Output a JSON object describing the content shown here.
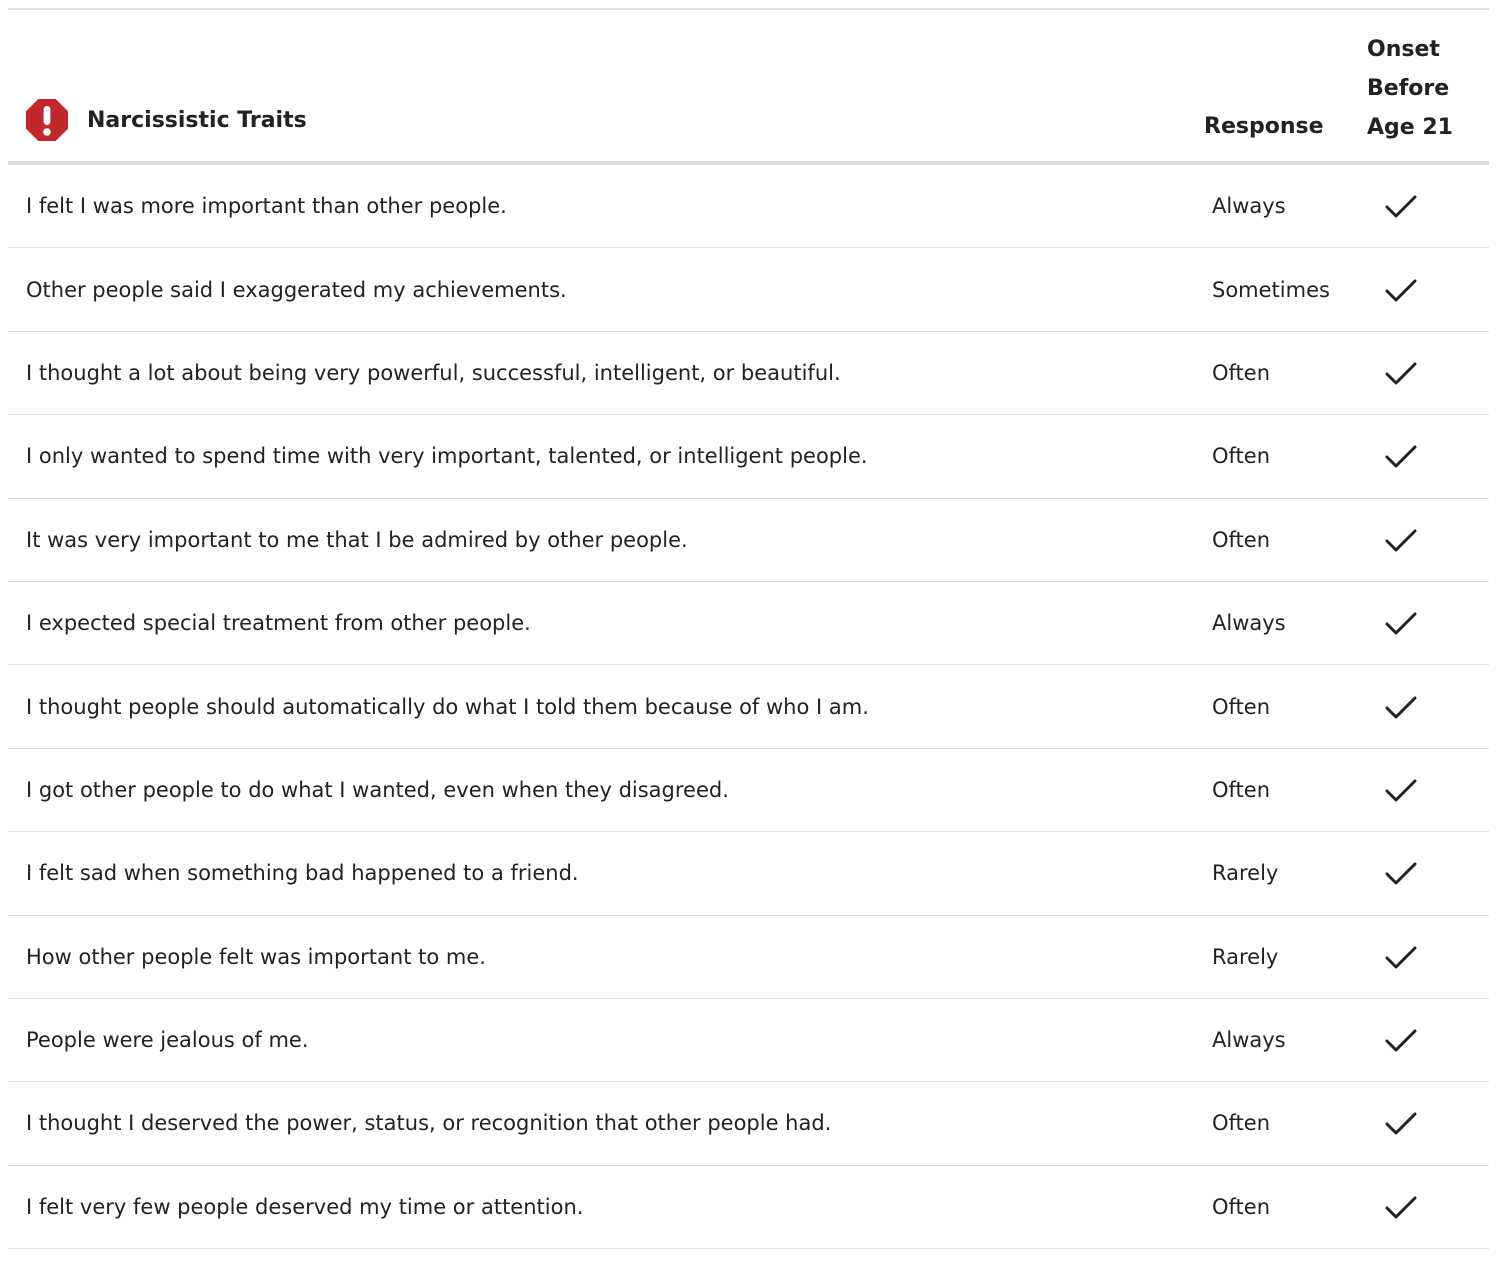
{
  "section": {
    "title": "Narcissistic Traits",
    "icon": "alert-octagon-icon",
    "icon_color": "#c0282d"
  },
  "columns": {
    "response": "Response",
    "onset": "Onset\nBefore\nAge 21"
  },
  "rows": [
    {
      "question": "I felt I was more important than other people.",
      "response": "Always",
      "onset_before_21": true
    },
    {
      "question": "Other people said I exaggerated my achievements.",
      "response": "Sometimes",
      "onset_before_21": true
    },
    {
      "question": "I thought a lot about being very powerful, successful, intelligent, or beautiful.",
      "response": "Often",
      "onset_before_21": true
    },
    {
      "question": "I only wanted to spend time with very important, talented, or intelligent people.",
      "response": "Often",
      "onset_before_21": true
    },
    {
      "question": "It was very important to me that I be admired by other people.",
      "response": "Often",
      "onset_before_21": true
    },
    {
      "question": "I expected special treatment from other people.",
      "response": "Always",
      "onset_before_21": true
    },
    {
      "question": "I thought people should automatically do what I told them because of who I am.",
      "response": "Often",
      "onset_before_21": true
    },
    {
      "question": "I got other people to do what I wanted, even when they disagreed.",
      "response": "Often",
      "onset_before_21": true
    },
    {
      "question": "I felt sad when something bad happened to a friend.",
      "response": "Rarely",
      "onset_before_21": true
    },
    {
      "question": "How other people felt was important to me.",
      "response": "Rarely",
      "onset_before_21": true
    },
    {
      "question": "People were jealous of me.",
      "response": "Always",
      "onset_before_21": true
    },
    {
      "question": "I thought I deserved the power, status, or recognition that other people had.",
      "response": "Often",
      "onset_before_21": true
    },
    {
      "question": "I felt very few people deserved my time or attention.",
      "response": "Often",
      "onset_before_21": true
    }
  ]
}
